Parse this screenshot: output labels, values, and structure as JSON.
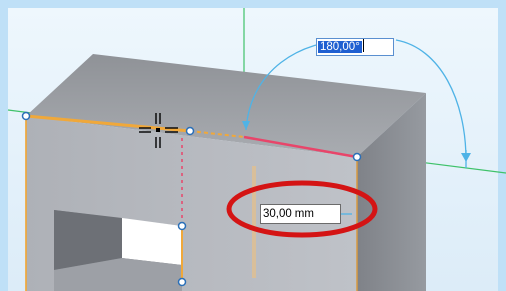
{
  "viewport": {
    "background_color": "#bfe0f7",
    "face_colors": {
      "top": "#9a9da2",
      "front": "#b6b9bf",
      "right": "#8e9197",
      "edge_highlight": "#f0a83a",
      "selected_edge": "#e8456a",
      "axis_green": "#3fc26a",
      "dimension_arc": "#4fb3e6",
      "callout_ring": "#d41414"
    }
  },
  "angle_input": {
    "value": "180,00",
    "unit": "°"
  },
  "length_input": {
    "value": "30,00",
    "unit": "mm"
  },
  "icons": [
    "move-cursor-icon",
    "keypoint-handle-icon"
  ]
}
